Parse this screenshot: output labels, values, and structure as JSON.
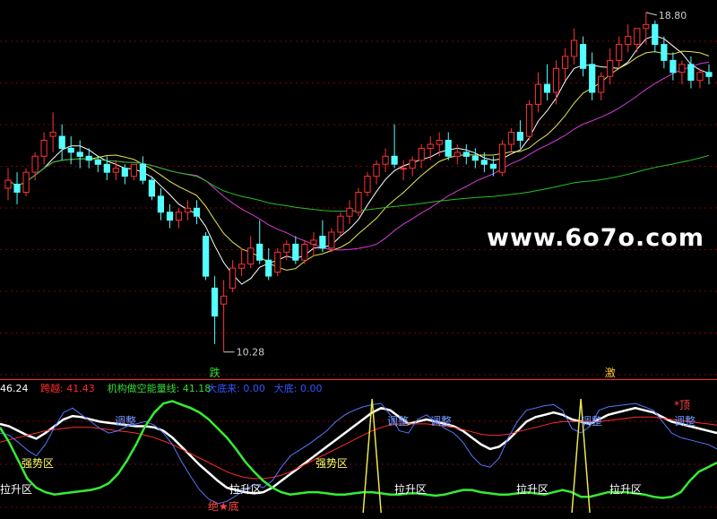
{
  "watermark": "www.6o7o.com",
  "colors": {
    "background": "#000000",
    "grid": "#8b0000",
    "divider": "#ff2a2a",
    "candle_up": "#ff3333",
    "candle_down": "#54ffff",
    "ma_short": "#ffffff",
    "ma_mid": "#e6e650",
    "ma_long": "#d63cd6",
    "ma_slow": "#25c025",
    "price_label": "#cccccc",
    "kuayue": "#ff2a2a",
    "jigou": "#33dd33",
    "dadi": "#3355ff",
    "zone_text": "#ffff66",
    "white_text": "#ffffff",
    "blue_text": "#7799ff",
    "red_text": "#ff4444"
  },
  "chart_data": [
    {
      "type": "candlestick",
      "title": "",
      "price_labels": {
        "high": "18.80",
        "low": "10.28"
      },
      "ylim": [
        9.8,
        19.0
      ],
      "grid": "horizontal dashed",
      "markers": [
        {
          "text": "跌",
          "x": 23,
          "color": "#33dd33"
        },
        {
          "text": "激",
          "x": 67,
          "color": "#ffcc33"
        }
      ],
      "candles": [
        {
          "o": 14.4,
          "h": 14.9,
          "c": 14.6,
          "l": 14.1
        },
        {
          "o": 14.5,
          "h": 14.8,
          "c": 14.3,
          "l": 14.0
        },
        {
          "o": 14.3,
          "h": 14.9,
          "c": 14.8,
          "l": 14.2
        },
        {
          "o": 14.8,
          "h": 15.3,
          "c": 15.2,
          "l": 14.6
        },
        {
          "o": 15.2,
          "h": 15.8,
          "c": 15.6,
          "l": 15.0
        },
        {
          "o": 15.7,
          "h": 16.3,
          "c": 15.8,
          "l": 15.3
        },
        {
          "o": 15.7,
          "h": 16.0,
          "c": 15.4,
          "l": 15.1
        },
        {
          "o": 15.4,
          "h": 15.7,
          "c": 15.3,
          "l": 15.0
        },
        {
          "o": 15.3,
          "h": 15.6,
          "c": 15.2,
          "l": 14.9
        },
        {
          "o": 15.2,
          "h": 15.4,
          "c": 15.1,
          "l": 14.9
        },
        {
          "o": 15.1,
          "h": 15.2,
          "c": 15.0,
          "l": 14.8
        },
        {
          "o": 15.0,
          "h": 15.2,
          "c": 14.8,
          "l": 14.6
        },
        {
          "o": 14.8,
          "h": 15.1,
          "c": 14.9,
          "l": 14.6
        },
        {
          "o": 14.9,
          "h": 15.0,
          "c": 14.7,
          "l": 14.5
        },
        {
          "o": 14.7,
          "h": 15.0,
          "c": 15.0,
          "l": 14.6
        },
        {
          "o": 15.0,
          "h": 15.2,
          "c": 14.6,
          "l": 14.5
        },
        {
          "o": 14.6,
          "h": 14.7,
          "c": 14.2,
          "l": 14.1
        },
        {
          "o": 14.2,
          "h": 14.4,
          "c": 13.8,
          "l": 13.6
        },
        {
          "o": 13.8,
          "h": 14.0,
          "c": 13.6,
          "l": 13.4
        },
        {
          "o": 13.6,
          "h": 13.9,
          "c": 13.8,
          "l": 13.4
        },
        {
          "o": 13.8,
          "h": 14.1,
          "c": 13.9,
          "l": 13.6
        },
        {
          "o": 13.9,
          "h": 14.1,
          "c": 13.7,
          "l": 13.5
        },
        {
          "o": 13.2,
          "h": 13.3,
          "c": 12.2,
          "l": 12.1
        },
        {
          "o": 11.9,
          "h": 12.2,
          "c": 11.2,
          "l": 10.5
        },
        {
          "o": 11.5,
          "h": 12.1,
          "c": 11.7,
          "l": 10.3
        },
        {
          "o": 11.9,
          "h": 12.6,
          "c": 12.4,
          "l": 11.8
        },
        {
          "o": 12.4,
          "h": 12.9,
          "c": 12.5,
          "l": 12.2
        },
        {
          "o": 12.5,
          "h": 13.2,
          "c": 12.9,
          "l": 12.4
        },
        {
          "o": 13.0,
          "h": 13.6,
          "c": 12.6,
          "l": 12.5
        },
        {
          "o": 12.6,
          "h": 12.9,
          "c": 12.2,
          "l": 12.1
        },
        {
          "o": 12.3,
          "h": 12.9,
          "c": 12.8,
          "l": 12.2
        },
        {
          "o": 12.8,
          "h": 13.1,
          "c": 13.0,
          "l": 12.6
        },
        {
          "o": 13.0,
          "h": 13.2,
          "c": 12.6,
          "l": 12.5
        },
        {
          "o": 12.6,
          "h": 13.1,
          "c": 13.0,
          "l": 12.5
        },
        {
          "o": 13.0,
          "h": 13.3,
          "c": 13.1,
          "l": 12.7
        },
        {
          "o": 13.2,
          "h": 13.6,
          "c": 12.9,
          "l": 12.8
        },
        {
          "o": 12.9,
          "h": 13.4,
          "c": 13.3,
          "l": 12.8
        },
        {
          "o": 13.3,
          "h": 13.8,
          "c": 13.7,
          "l": 13.2
        },
        {
          "o": 13.7,
          "h": 14.1,
          "c": 13.9,
          "l": 13.5
        },
        {
          "o": 13.8,
          "h": 14.4,
          "c": 14.3,
          "l": 13.7
        },
        {
          "o": 14.3,
          "h": 14.8,
          "c": 14.7,
          "l": 14.2
        },
        {
          "o": 14.7,
          "h": 15.1,
          "c": 15.0,
          "l": 14.5
        },
        {
          "o": 15.0,
          "h": 15.4,
          "c": 15.2,
          "l": 14.8
        },
        {
          "o": 15.2,
          "h": 16.0,
          "c": 15.0,
          "l": 14.9
        },
        {
          "o": 14.9,
          "h": 15.1,
          "c": 14.9,
          "l": 14.6
        },
        {
          "o": 14.9,
          "h": 15.2,
          "c": 15.1,
          "l": 14.7
        },
        {
          "o": 15.1,
          "h": 15.5,
          "c": 15.4,
          "l": 14.9
        },
        {
          "o": 15.4,
          "h": 15.7,
          "c": 15.5,
          "l": 15.1
        },
        {
          "o": 15.5,
          "h": 15.8,
          "c": 15.6,
          "l": 15.2
        },
        {
          "o": 15.6,
          "h": 15.8,
          "c": 15.2,
          "l": 15.1
        },
        {
          "o": 15.2,
          "h": 15.5,
          "c": 15.3,
          "l": 15.0
        },
        {
          "o": 15.3,
          "h": 15.5,
          "c": 15.2,
          "l": 15.0
        },
        {
          "o": 15.2,
          "h": 15.4,
          "c": 15.1,
          "l": 14.9
        },
        {
          "o": 15.1,
          "h": 15.3,
          "c": 15.0,
          "l": 14.8
        },
        {
          "o": 15.0,
          "h": 15.2,
          "c": 14.9,
          "l": 14.7
        },
        {
          "o": 14.8,
          "h": 15.6,
          "c": 15.5,
          "l": 14.7
        },
        {
          "o": 15.5,
          "h": 15.9,
          "c": 15.8,
          "l": 15.3
        },
        {
          "o": 15.8,
          "h": 16.1,
          "c": 15.6,
          "l": 15.4
        },
        {
          "o": 15.7,
          "h": 16.6,
          "c": 16.5,
          "l": 15.6
        },
        {
          "o": 16.5,
          "h": 17.3,
          "c": 17.0,
          "l": 16.3
        },
        {
          "o": 17.0,
          "h": 17.5,
          "c": 16.8,
          "l": 16.6
        },
        {
          "o": 16.8,
          "h": 17.6,
          "c": 17.4,
          "l": 16.5
        },
        {
          "o": 17.4,
          "h": 17.9,
          "c": 17.7,
          "l": 17.1
        },
        {
          "o": 17.7,
          "h": 18.4,
          "c": 18.1,
          "l": 17.5
        },
        {
          "o": 18.0,
          "h": 18.2,
          "c": 17.4,
          "l": 17.2
        },
        {
          "o": 17.5,
          "h": 17.8,
          "c": 16.8,
          "l": 16.6
        },
        {
          "o": 16.8,
          "h": 17.3,
          "c": 17.2,
          "l": 16.6
        },
        {
          "o": 17.2,
          "h": 17.9,
          "c": 17.6,
          "l": 17.0
        },
        {
          "o": 17.6,
          "h": 18.2,
          "c": 18.0,
          "l": 17.4
        },
        {
          "o": 18.0,
          "h": 18.5,
          "c": 18.2,
          "l": 17.8
        },
        {
          "o": 18.0,
          "h": 18.3,
          "c": 18.4,
          "l": 17.8
        },
        {
          "o": 18.4,
          "h": 18.8,
          "c": 18.5,
          "l": 18.0
        },
        {
          "o": 18.5,
          "h": 18.6,
          "c": 18.0,
          "l": 17.8
        },
        {
          "o": 18.0,
          "h": 18.2,
          "c": 17.6,
          "l": 17.4
        },
        {
          "o": 17.6,
          "h": 17.8,
          "c": 17.3,
          "l": 17.1
        },
        {
          "o": 17.3,
          "h": 17.6,
          "c": 17.5,
          "l": 17.0
        },
        {
          "o": 17.5,
          "h": 17.7,
          "c": 17.1,
          "l": 16.9
        },
        {
          "o": 17.1,
          "h": 17.4,
          "c": 17.3,
          "l": 16.9
        },
        {
          "o": 17.3,
          "h": 17.5,
          "c": 17.2,
          "l": 17.0
        }
      ]
    },
    {
      "type": "line",
      "title": "",
      "legend": [
        {
          "text": "46.24",
          "color": "#ffffff"
        },
        {
          "text": "跨越: 41.43",
          "color": "#ff2a2a"
        },
        {
          "text": "机构做空能量线: 41.18",
          "color": "#33dd33"
        },
        {
          "text": "大底来: 0.00",
          "color": "#3355ff"
        },
        {
          "text": "大底: 0.00",
          "color": "#3355ff"
        }
      ],
      "annotations": [
        {
          "text": "调整",
          "x": 0.16,
          "y": 0.18,
          "color": "#7799ff"
        },
        {
          "text": "强势区",
          "x": 0.03,
          "y": 0.55,
          "color": "#ffff66"
        },
        {
          "text": "拉升区",
          "x": 0.0,
          "y": 0.78,
          "color": "#ffffff"
        },
        {
          "text": "绝★底",
          "x": 0.29,
          "y": 0.93,
          "color": "#ff4444"
        },
        {
          "text": "拉升区",
          "x": 0.32,
          "y": 0.78,
          "color": "#ffffff"
        },
        {
          "text": "强势区",
          "x": 0.44,
          "y": 0.55,
          "color": "#ffff66"
        },
        {
          "text": "调整",
          "x": 0.54,
          "y": 0.18,
          "color": "#7799ff"
        },
        {
          "text": "调整",
          "x": 0.6,
          "y": 0.18,
          "color": "#7799ff"
        },
        {
          "text": "拉升区",
          "x": 0.55,
          "y": 0.78,
          "color": "#ffffff"
        },
        {
          "text": "拉升区",
          "x": 0.72,
          "y": 0.78,
          "color": "#ffffff"
        },
        {
          "text": "调整",
          "x": 0.81,
          "y": 0.18,
          "color": "#7799ff"
        },
        {
          "text": "拉升区",
          "x": 0.85,
          "y": 0.78,
          "color": "#ffffff"
        },
        {
          "text": "*顶",
          "x": 0.94,
          "y": 0.04,
          "color": "#ff4444"
        },
        {
          "text": "调整",
          "x": 0.94,
          "y": 0.18,
          "color": "#7799ff"
        }
      ],
      "ylim": [
        0,
        100
      ],
      "series": [
        {
          "name": "",
          "color": "#ffffff",
          "values": [
            78,
            76,
            72,
            68,
            65,
            70,
            76,
            82,
            85,
            84,
            82,
            80,
            79,
            78,
            77,
            76,
            76,
            75,
            72,
            66,
            58,
            50,
            42,
            35,
            28,
            22,
            20,
            18,
            17,
            18,
            22,
            28,
            34,
            40,
            46,
            52,
            58,
            64,
            70,
            76,
            82,
            88,
            92,
            90,
            84,
            78,
            80,
            82,
            80,
            78,
            76,
            72,
            66,
            60,
            56,
            58,
            64,
            72,
            80,
            84,
            86,
            88,
            86,
            82,
            80,
            78,
            82,
            86,
            88,
            90,
            92,
            90,
            88,
            84,
            80,
            78,
            76,
            74,
            72,
            70
          ]
        },
        {
          "name": "",
          "color": "#ff2a2a",
          "values": [
            62,
            64,
            66,
            68,
            70,
            72,
            73,
            74,
            75,
            75,
            75,
            74,
            73,
            72,
            71,
            70,
            68,
            66,
            63,
            60,
            56,
            52,
            48,
            44,
            40,
            36,
            33,
            31,
            30,
            30,
            31,
            33,
            36,
            40,
            44,
            48,
            52,
            56,
            60,
            64,
            68,
            72,
            75,
            77,
            78,
            78,
            78,
            78,
            77,
            76,
            75,
            73,
            71,
            69,
            68,
            68,
            69,
            71,
            73,
            75,
            77,
            79,
            80,
            80,
            80,
            80,
            80,
            81,
            82,
            83,
            84,
            84,
            84,
            83,
            82,
            81,
            80,
            79,
            78,
            77
          ]
        },
        {
          "name": "",
          "color": "#5577ff",
          "values": [
            70,
            68,
            62,
            55,
            50,
            60,
            75,
            88,
            92,
            86,
            80,
            74,
            70,
            72,
            76,
            78,
            80,
            77,
            70,
            60,
            45,
            32,
            20,
            12,
            8,
            10,
            15,
            20,
            25,
            22,
            28,
            40,
            50,
            55,
            60,
            66,
            72,
            80,
            86,
            90,
            93,
            95,
            96,
            86,
            72,
            70,
            82,
            86,
            80,
            74,
            70,
            62,
            50,
            42,
            40,
            48,
            66,
            80,
            90,
            92,
            94,
            95,
            90,
            74,
            70,
            76,
            90,
            93,
            94,
            95,
            96,
            93,
            90,
            80,
            70,
            66,
            64,
            62,
            60,
            56
          ]
        },
        {
          "name": "",
          "color": "#33ee33",
          "values": [
            75,
            62,
            46,
            30,
            22,
            18,
            16,
            17,
            18,
            19,
            20,
            22,
            26,
            34,
            46,
            60,
            76,
            88,
            96,
            98,
            95,
            92,
            88,
            82,
            74,
            66,
            56,
            45,
            36,
            28,
            22,
            18,
            16,
            17,
            18,
            18,
            17,
            16,
            16,
            17,
            18,
            18,
            17,
            16,
            16,
            17,
            17,
            16,
            15,
            16,
            18,
            20,
            20,
            18,
            17,
            16,
            16,
            17,
            18,
            17,
            16,
            18,
            20,
            18,
            14,
            14,
            16,
            18,
            18,
            18,
            17,
            16,
            14,
            13,
            14,
            18,
            28,
            36,
            40,
            44
          ]
        }
      ],
      "spikes": [
        {
          "index": 41,
          "color": "#e8e850"
        },
        {
          "index": 64,
          "color": "#e8e850"
        }
      ]
    }
  ]
}
